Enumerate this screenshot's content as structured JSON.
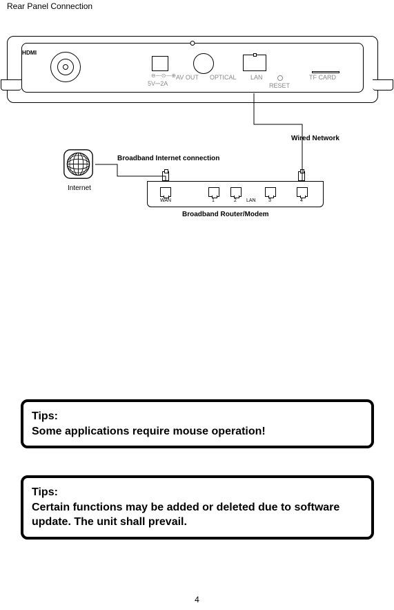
{
  "title": "Rear Panel Connection",
  "device": {
    "labels": {
      "power": "5V⎓2A",
      "power_sym": "⊖―⊙―⊕",
      "avout": "AV OUT",
      "optical": "OPTICAL",
      "lan": "LAN",
      "reset": "RESET",
      "hdmi": "HDMI",
      "tfcard": "TF CARD"
    }
  },
  "diagram": {
    "wired_network": "Wired Network",
    "broadband_connection": "Broadband Internet connection",
    "internet": "Internet",
    "router_label": "Broadband Router/Modem",
    "router_ports": {
      "wan": "WAN",
      "p1": "1",
      "p2": "2",
      "lan": "LAN",
      "p3": "3",
      "p4": "4"
    }
  },
  "tips": {
    "tip1_heading": "Tips:",
    "tip1_body": "Some applications require mouse operation!",
    "tip2_heading": "Tips:",
    "tip2_body": "Certain functions may be added or deleted due to software update. The unit shall prevail."
  },
  "page_number": "4"
}
